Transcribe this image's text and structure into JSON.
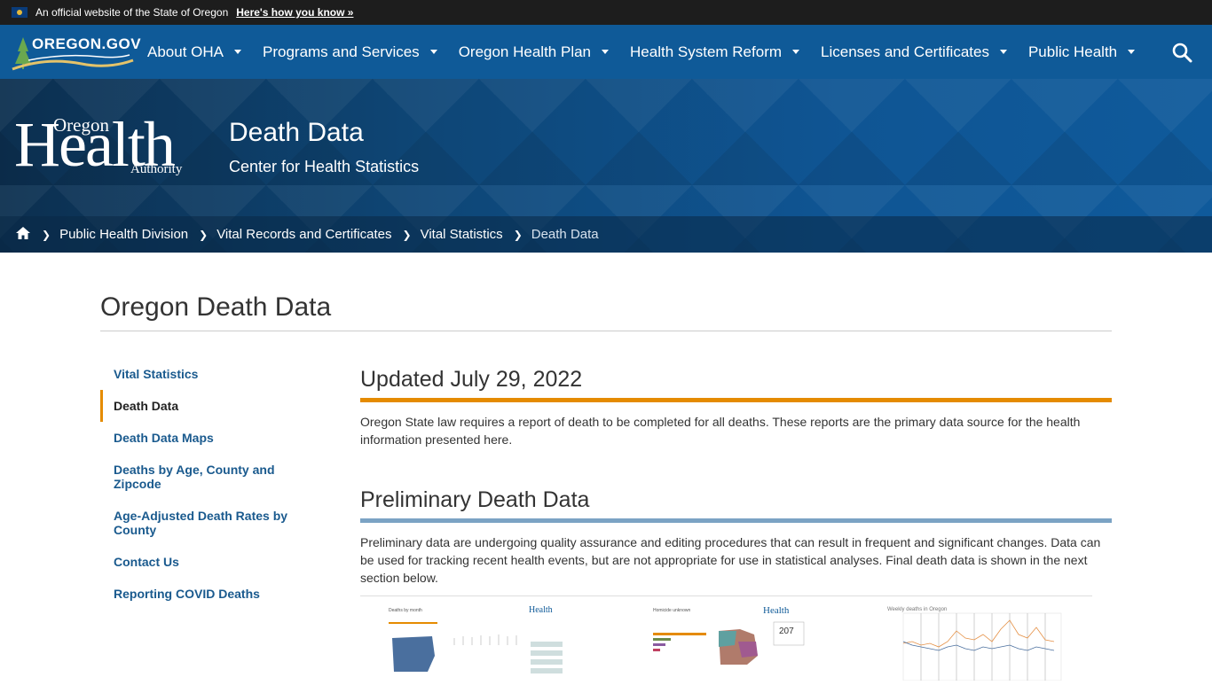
{
  "official_bar": {
    "text": "An official website of the State of Oregon",
    "link": "Here's how you know »"
  },
  "logo": {
    "text": "OREGON.GOV"
  },
  "nav": {
    "items": [
      {
        "label": "About OHA"
      },
      {
        "label": "Programs and Services"
      },
      {
        "label": "Oregon Health Plan"
      },
      {
        "label": "Health System Reform"
      },
      {
        "label": "Licenses and Certificates"
      },
      {
        "label": "Public Health"
      }
    ]
  },
  "hero": {
    "logo_oregon": "Oregon",
    "logo_health": "Health",
    "logo_authority": "Authority",
    "title": "Death Data",
    "subtitle": "Center for Health Statistics"
  },
  "breadcrumb": {
    "items": [
      "Public Health Division",
      "Vital Records and Certificates",
      "Vital Statistics"
    ],
    "current": "Death Data"
  },
  "page": {
    "title": "Oregon Death Data"
  },
  "sidenav": {
    "items": [
      {
        "label": "Vital Statistics"
      },
      {
        "label": "Death Data"
      },
      {
        "label": "Death Data Maps"
      },
      {
        "label": "Deaths by Age, County and Zipcode"
      },
      {
        "label": "Age-Adjusted Death Rates by County"
      },
      {
        "label": "Contact Us"
      },
      {
        "label": "Reporting COVID Deaths"
      }
    ],
    "active_index": 1
  },
  "content": {
    "section1": {
      "heading": "Updated July 29, 2022",
      "body": "Oregon State law requires a report of death to be completed for all deaths. These reports are the primary data source for the health information presented here."
    },
    "section2": {
      "heading": "Preliminary Death Data",
      "body": "Preliminary data are undergoing quality assurance and editing procedures that can result in frequent and significant changes. Data can be used for tracking recent health events, but are not appropriate for use in statistical analyses. Final death data is shown in the next section below."
    }
  },
  "thumbnails": {
    "t1": {
      "title": "Deaths by month",
      "brand": "Health"
    },
    "t2": {
      "title": "Homicide unknown",
      "brand": "Health",
      "value": "207"
    },
    "t3": {
      "title": "Weekly deaths in Oregon"
    }
  },
  "colors": {
    "nav": "#0f5a98",
    "accent_orange": "#e58b00",
    "accent_blue": "#7ba3c4",
    "link": "#1a5a8e"
  }
}
